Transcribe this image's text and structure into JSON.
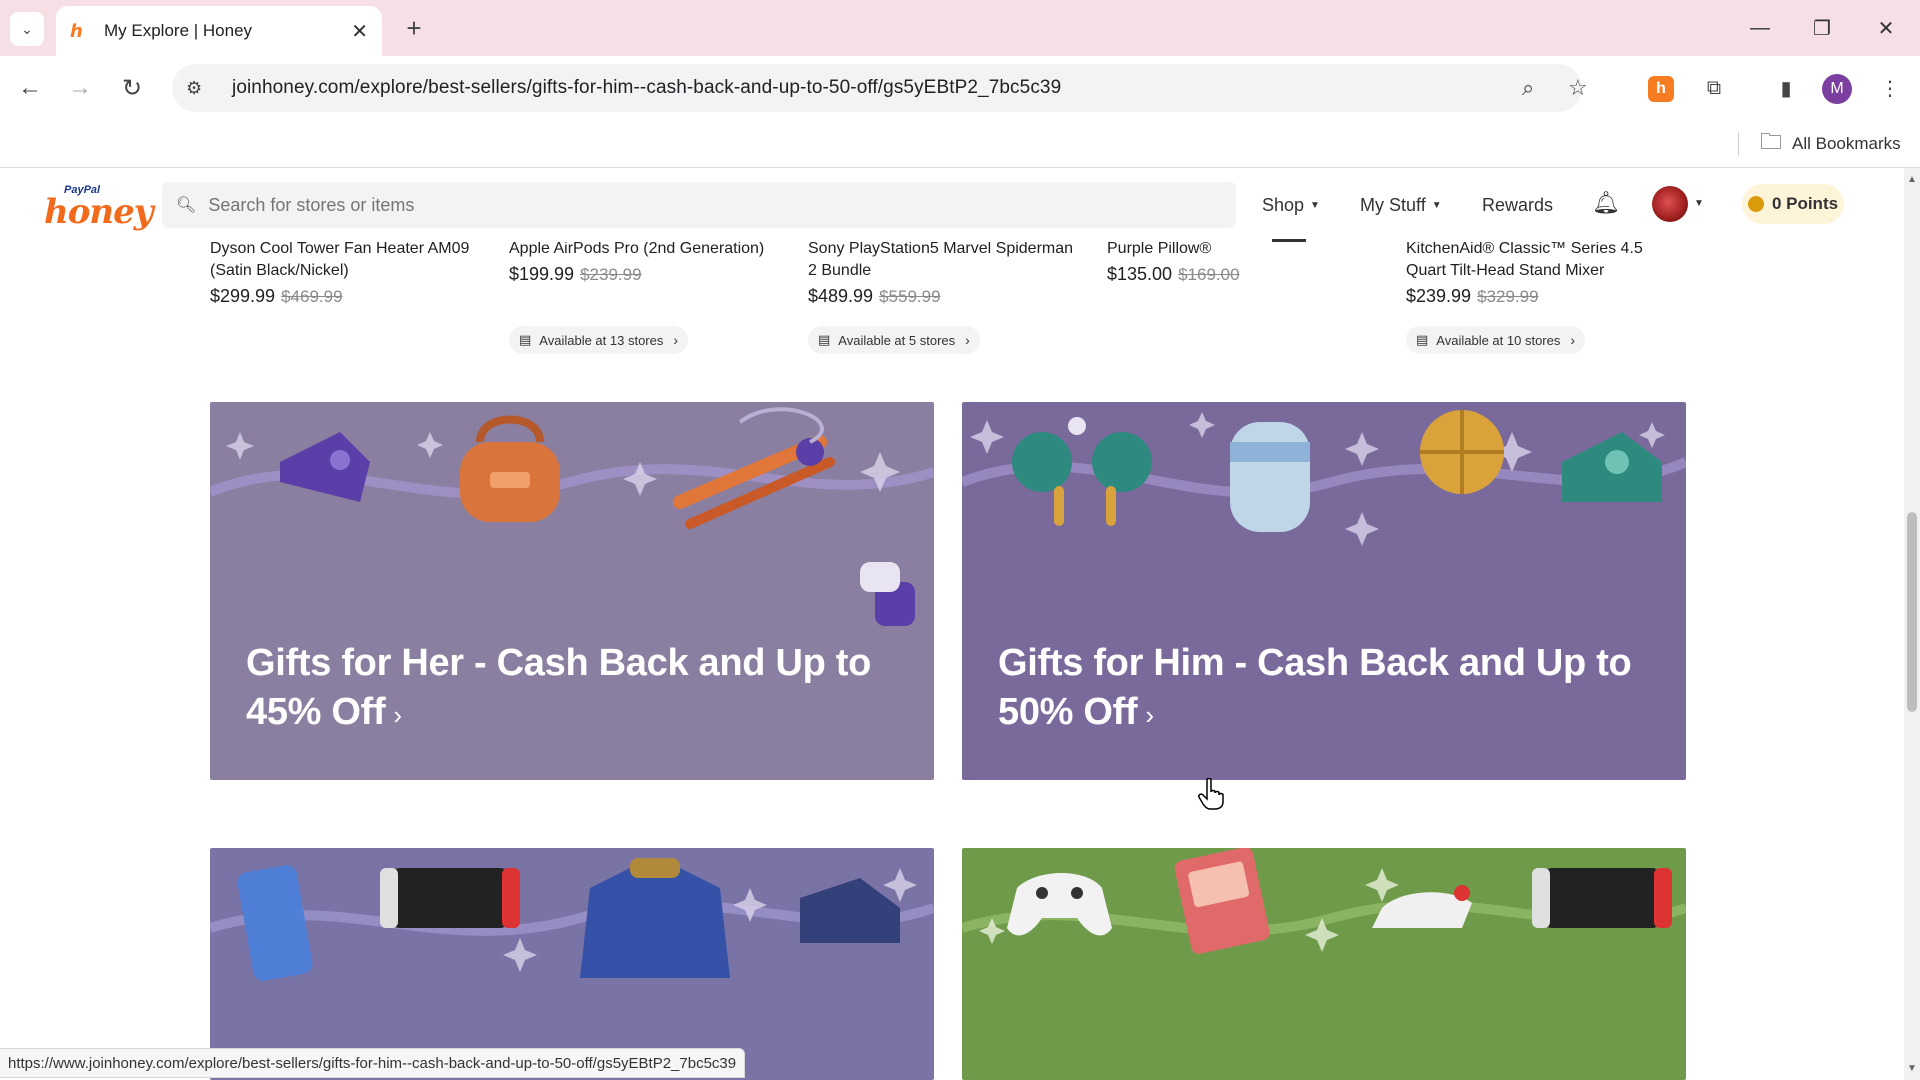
{
  "browser": {
    "tab_title": "My Explore | Honey",
    "tab_close": "✕",
    "new_tab": "+",
    "url": "joinhoney.com/explore/best-sellers/gifts-for-him--cash-back-and-up-to-50-off/gs5yEBtP2_7bc5c39",
    "bookmarks_label": "All Bookmarks",
    "profile_initial": "M",
    "status_url": "https://www.joinhoney.com/explore/best-sellers/gifts-for-him--cash-back-and-up-to-50-off/gs5yEBtP2_7bc5c39"
  },
  "honey_nav": {
    "logo_paypal": "PayPal",
    "logo_honey": "honey",
    "search_placeholder": "Search for stores or items",
    "shop": "Shop",
    "my_stuff": "My Stuff",
    "rewards": "Rewards",
    "points": "0 Points"
  },
  "products": [
    {
      "name": "Dyson Cool Tower Fan Heater AM09 (Satin Black/Nickel)",
      "price": "$299.99",
      "was": "$469.99",
      "availability": ""
    },
    {
      "name": "Apple AirPods Pro (2nd Generation)",
      "price": "$199.99",
      "was": "$239.99",
      "availability": "Available at 13 stores"
    },
    {
      "name": "Sony PlayStation5 Marvel Spiderman 2 Bundle",
      "price": "$489.99",
      "was": "$559.99",
      "availability": "Available at 5 stores"
    },
    {
      "name": "Purple Pillow®",
      "price": "$135.00",
      "was": "$169.00",
      "availability": ""
    },
    {
      "name": "KitchenAid® Classic™ Series 4.5 Quart Tilt-Head Stand Mixer",
      "price": "$239.99",
      "was": "$329.99",
      "availability": "Available at 10 stores"
    }
  ],
  "banners": [
    {
      "title": "Gifts for Her - Cash Back and Up to 45% Off",
      "arrow": "›",
      "color": "#8a7fa0"
    },
    {
      "title": "Gifts for Him - Cash Back and Up to 50% Off",
      "arrow": "›",
      "color": "#7a6a9c"
    },
    {
      "title": "",
      "color": "#7a74a6"
    },
    {
      "title": "",
      "color": "#6e9a4a"
    }
  ]
}
